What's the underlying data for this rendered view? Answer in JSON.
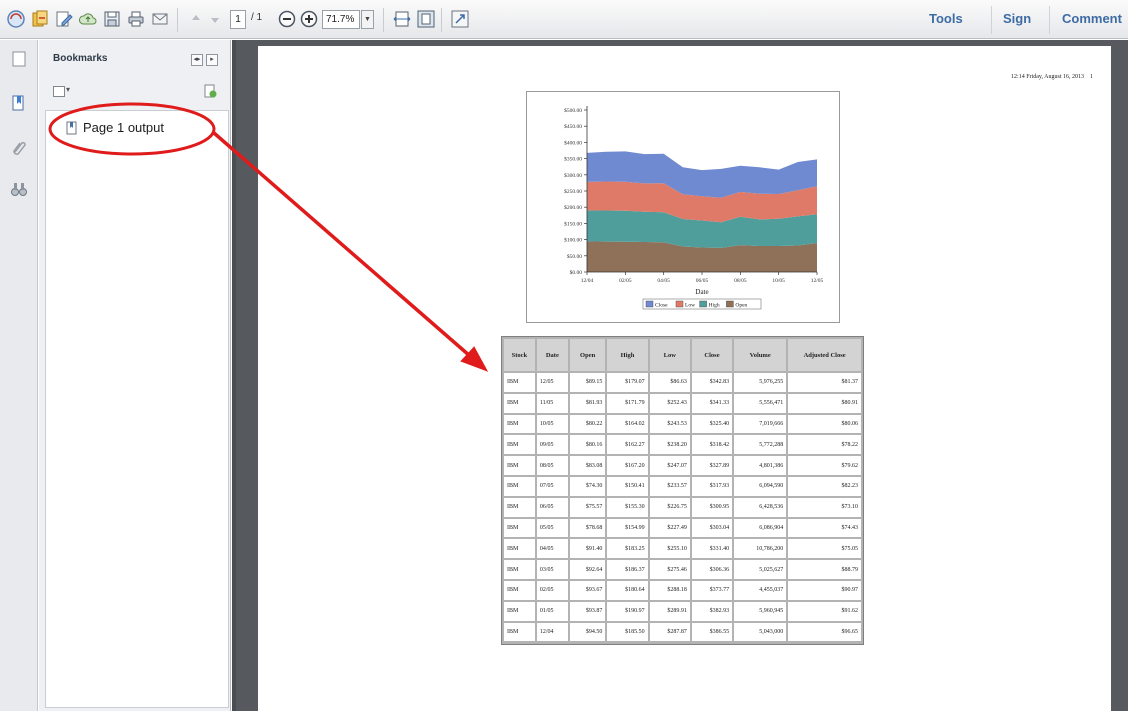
{
  "toolbar": {
    "page_current": "1",
    "page_total": "/ 1",
    "zoom": "71.7%",
    "links": {
      "tools": "Tools",
      "sign": "Sign",
      "comment": "Comment"
    }
  },
  "sidebar": {
    "title": "Bookmarks",
    "bookmark_label": "Page 1 output"
  },
  "page": {
    "header_text": "12:14 Friday, August 16, 2013",
    "page_number": "1"
  },
  "chart_data": {
    "type": "area",
    "stacked": true,
    "title": "",
    "xlabel": "Date",
    "ylabel": "",
    "x": [
      "12/04",
      "01/05",
      "02/05",
      "03/05",
      "04/05",
      "05/05",
      "06/05",
      "07/05",
      "08/05",
      "09/05",
      "10/05",
      "11/05",
      "12/05"
    ],
    "x_tick_labels": [
      "12/04",
      "02/05",
      "04/05",
      "06/05",
      "08/05",
      "10/05",
      "12/05"
    ],
    "y_tick_labels": [
      "$0.00",
      "$50.00",
      "$100.00",
      "$150.00",
      "$200.00",
      "$250.00",
      "$300.00",
      "$350.00",
      "$400.00",
      "$450.00",
      "$500.00"
    ],
    "ylim": [
      0,
      500
    ],
    "series": [
      {
        "name": "Open",
        "color": "#8f7058",
        "values": [
          94.5,
          93.87,
          93.67,
          92.64,
          91.4,
          78.68,
          75.57,
          74.3,
          83.08,
          80.16,
          80.22,
          81.93,
          89.15
        ]
      },
      {
        "name": "High",
        "color": "#4f9e9c",
        "values": [
          95.5,
          95.87,
          95.64,
          93.37,
          93.25,
          84.99,
          83.3,
          79.41,
          87.2,
          82.27,
          84.02,
          89.79,
          89.07
        ]
      },
      {
        "name": "Low",
        "color": "#df7a68",
        "values": [
          87.97,
          89.51,
          89.18,
          87.48,
          89.1,
          76.49,
          74.75,
          75.57,
          77.07,
          79.2,
          76.52,
          80.43,
          86.63
        ]
      },
      {
        "name": "Close",
        "color": "#6f8ad0",
        "values": [
          89.55,
          91.95,
          93.77,
          90.34,
          91.4,
          83.04,
          80.95,
          88.93,
          80.89,
          81.42,
          75.4,
          87.33,
          82.83
        ]
      }
    ],
    "legend": [
      "Close",
      "Low",
      "High",
      "Open"
    ],
    "legend_position": "bottom"
  },
  "table": {
    "columns": [
      "Stock",
      "Date",
      "Open",
      "High",
      "Low",
      "Close",
      "Volume",
      "Adjusted Close"
    ],
    "rows": [
      [
        "IBM",
        "12/05",
        "$89.15",
        "$179.07",
        "$86.63",
        "$342.83",
        "5,976,255",
        "$81.37"
      ],
      [
        "IBM",
        "11/05",
        "$81.93",
        "$171.79",
        "$252.43",
        "$341.33",
        "5,556,471",
        "$80.91"
      ],
      [
        "IBM",
        "10/05",
        "$80.22",
        "$164.02",
        "$243.53",
        "$325.40",
        "7,019,666",
        "$80.06"
      ],
      [
        "IBM",
        "09/05",
        "$80.16",
        "$162.27",
        "$238.20",
        "$318.42",
        "5,772,288",
        "$78.22"
      ],
      [
        "IBM",
        "08/05",
        "$83.08",
        "$167.20",
        "$247.07",
        "$327.89",
        "4,801,386",
        "$79.62"
      ],
      [
        "IBM",
        "07/05",
        "$74.30",
        "$150.41",
        "$233.57",
        "$317.93",
        "6,094,590",
        "$82.23"
      ],
      [
        "IBM",
        "06/05",
        "$75.57",
        "$155.30",
        "$226.75",
        "$300.95",
        "6,428,536",
        "$73.10"
      ],
      [
        "IBM",
        "05/05",
        "$78.68",
        "$154.99",
        "$227.49",
        "$303.04",
        "6,086,904",
        "$74.43"
      ],
      [
        "IBM",
        "04/05",
        "$91.40",
        "$183.25",
        "$255.10",
        "$331.40",
        "10,786,200",
        "$75.05"
      ],
      [
        "IBM",
        "03/05",
        "$92.64",
        "$186.37",
        "$275.46",
        "$306.36",
        "5,025,627",
        "$88.79"
      ],
      [
        "IBM",
        "02/05",
        "$93.67",
        "$180.64",
        "$288.18",
        "$373.77",
        "4,455,037",
        "$90.97"
      ],
      [
        "IBM",
        "01/05",
        "$93.87",
        "$190.97",
        "$289.91",
        "$382.93",
        "5,960,945",
        "$91.62"
      ],
      [
        "IBM",
        "12/04",
        "$94.50",
        "$185.50",
        "$287.87",
        "$386.55",
        "5,043,000",
        "$96.65"
      ]
    ]
  }
}
